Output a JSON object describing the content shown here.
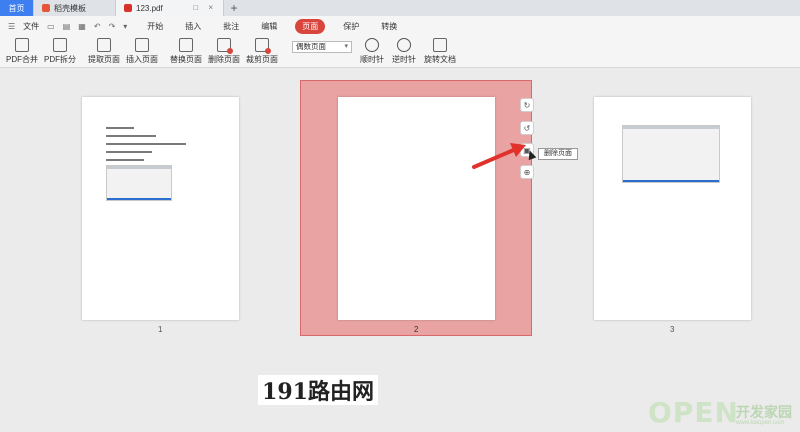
{
  "tabs": [
    {
      "label": "首页"
    },
    {
      "label": "稻壳模板"
    },
    {
      "label": "123.pdf"
    }
  ],
  "tab_controls": "□ ×",
  "newtab": "+",
  "menu": {
    "file": "文件",
    "items": [
      "开始",
      "插入",
      "批注",
      "编辑",
      "页面",
      "保护",
      "转换"
    ],
    "active": "页面"
  },
  "ribbon": {
    "buttons": [
      "PDF合并",
      "PDF拆分",
      "提取页面",
      "插入页面",
      "替换页面",
      "删除页面",
      "裁剪页面"
    ],
    "select_value": "偶数页面",
    "rotate_buttons": [
      "顺时针",
      "逆时针",
      "旋转文档"
    ]
  },
  "pages": [
    "1",
    "2",
    "3"
  ],
  "tooltip": "删除页面",
  "watermark1": "191路由网",
  "watermark2": "OPEN",
  "watermark2b": "开发家园",
  "watermark2c": "www.kaiopen.com"
}
